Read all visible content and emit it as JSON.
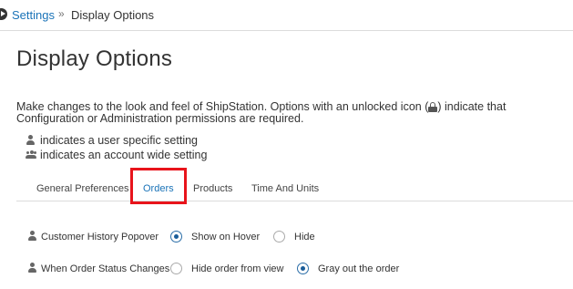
{
  "breadcrumb": {
    "root_label": "Settings",
    "separator": "»",
    "current_label": "Display Options"
  },
  "page": {
    "title": "Display Options",
    "intro_before_icon": "Make changes to the look and feel of ShipStation. Options with an unlocked icon (",
    "intro_after_icon": ") indicate that Configuration or Administration permissions are required."
  },
  "legend": {
    "user_specific": "indicates a user specific setting",
    "account_wide": "indicates an account wide setting"
  },
  "tabs": [
    {
      "label": "General Preferences",
      "active": false
    },
    {
      "label": "Orders",
      "active": true
    },
    {
      "label": "Products",
      "active": false
    },
    {
      "label": "Time And Units",
      "active": false
    }
  ],
  "settings": [
    {
      "label": "Customer History Popover",
      "scope_icon": "user-icon",
      "options": [
        {
          "label": "Show on Hover",
          "selected": true
        },
        {
          "label": "Hide",
          "selected": false
        }
      ]
    },
    {
      "label": "When Order Status Changes",
      "scope_icon": "user-icon",
      "options": [
        {
          "label": "Hide order from view",
          "selected": false
        },
        {
          "label": "Gray out the order",
          "selected": true
        }
      ]
    }
  ],
  "colors": {
    "link": "#1a73b8",
    "highlight_box": "#e8141b",
    "radio_checked": "#1a5d99"
  }
}
